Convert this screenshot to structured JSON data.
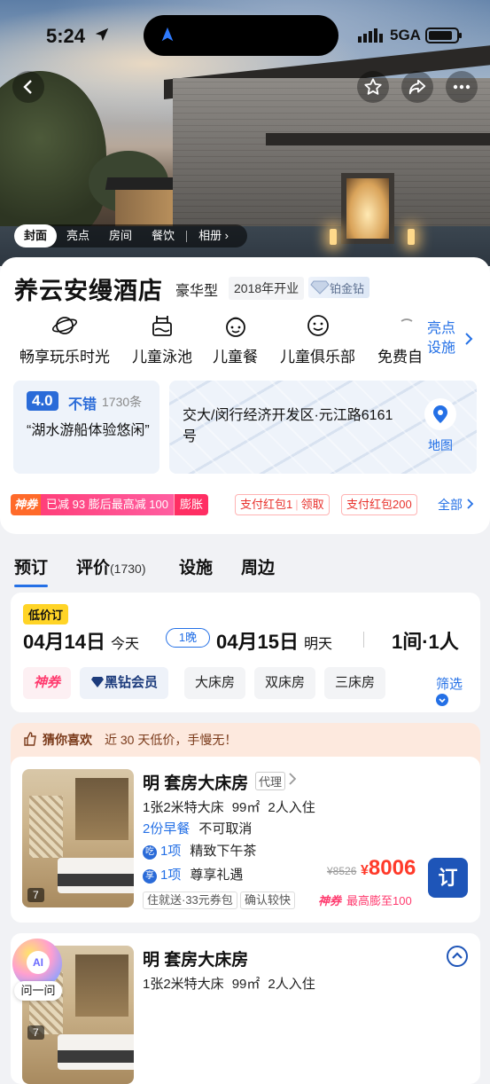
{
  "status": {
    "time": "5:24",
    "network": "5GA"
  },
  "gallery": {
    "tabs": [
      "封面",
      "亮点",
      "房间",
      "餐饮",
      "相册 ›"
    ],
    "active_tab": 0
  },
  "hotel": {
    "name": "养云安缦酒店",
    "type": "豪华型",
    "year": "2018年开业",
    "diamond": "铂金钻"
  },
  "features": {
    "items": [
      {
        "label": "畅享玩乐时光",
        "icon": "planet-icon"
      },
      {
        "label": "儿童泳池",
        "icon": "pool-icon"
      },
      {
        "label": "儿童餐",
        "icon": "kids-meal-icon"
      },
      {
        "label": "儿童俱乐部",
        "icon": "smile-icon"
      },
      {
        "label": "免费自",
        "icon": "partial-icon"
      }
    ],
    "more_line1": "亮点",
    "more_line2": "设施"
  },
  "rating": {
    "score": "4.0",
    "word": "不错",
    "count": "1730条",
    "review": "“湖水游船体验悠闲”"
  },
  "address": {
    "text": "交大/闵行经济开发区·元江路6161号",
    "map_label": "地图"
  },
  "promos": {
    "shen_label": "神券",
    "shen_text": "已减 93 膨后最高减 100",
    "swell": "膨胀",
    "coupon1_a": "支付红包1",
    "coupon1_b": "领取",
    "coupon2_a": "支付红包200",
    "all": "全部"
  },
  "nav": {
    "tabs": [
      {
        "label": "预订"
      },
      {
        "label": "评价",
        "count": "(1730)"
      },
      {
        "label": "设施"
      },
      {
        "label": "周边"
      }
    ],
    "active": 0
  },
  "booking": {
    "low_price": "低价订",
    "checkin": "04月14日",
    "checkin_sub": "今天",
    "nights": "1晚",
    "checkout": "04月15日",
    "checkout_sub": "明天",
    "rooms": "1间·1人",
    "filters": [
      "神券",
      "黑钻会员",
      "大床房",
      "双床房",
      "三床房"
    ],
    "filter_btn": "筛选"
  },
  "guess": {
    "title": "猜你喜欢",
    "sub": "近 30 天低价，手慢无！"
  },
  "rooms": [
    {
      "name": "明 套房大床房",
      "agent": "代理",
      "bed": "1张2米特大床",
      "area": "99㎡",
      "guests": "2人入住",
      "breakfast": "2份早餐",
      "cancel": "不可取消",
      "perk1_icon": "吃",
      "perk1_count": "1项",
      "perk1_text": "精致下午茶",
      "perk2_icon": "享",
      "perk2_count": "1项",
      "perk2_text": "尊享礼遇",
      "tag1": "住就送·33元券包",
      "tag2": "确认较快",
      "old_price": "¥8526",
      "price": "8006",
      "currency": "¥",
      "shen": "神券",
      "shen_text": "最高膨至100",
      "order": "订",
      "photos": "7"
    },
    {
      "name": "明 套房大床房",
      "bed": "1张2米特大床",
      "area": "99㎡",
      "guests": "2人入住",
      "photos": "7"
    }
  ],
  "ai": {
    "label": "问一问",
    "face": "AI"
  },
  "colors": {
    "accent": "#2470e6",
    "price": "#ff3a2a",
    "brand_dark": "#1e55b8"
  }
}
